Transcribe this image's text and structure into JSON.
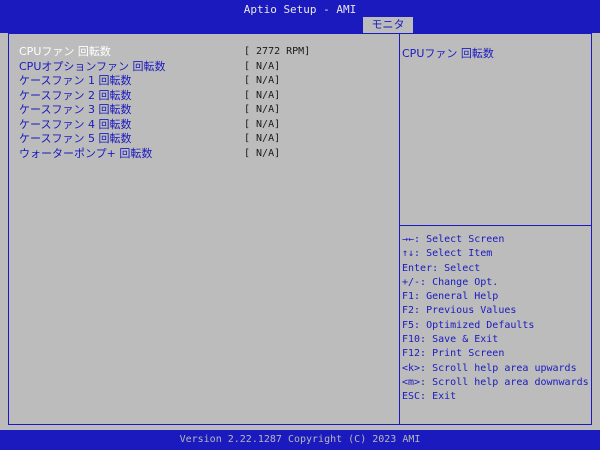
{
  "header": {
    "app_title": "Aptio Setup - AMI",
    "tab_label": "モニタ"
  },
  "settings": [
    {
      "label": "CPUファン 回転数",
      "value": "[  2772 RPM]"
    },
    {
      "label": "CPUオプションファン 回転数",
      "value": "[  N/A]"
    },
    {
      "label": "ケースファン 1 回転数",
      "value": "[  N/A]"
    },
    {
      "label": "ケースファン 2 回転数",
      "value": "[  N/A]"
    },
    {
      "label": "ケースファン 3 回転数",
      "value": "[  N/A]"
    },
    {
      "label": "ケースファン 4 回転数",
      "value": "[  N/A]"
    },
    {
      "label": "ケースファン 5 回転数",
      "value": "[  N/A]"
    },
    {
      "label": "ウォーターポンプ+ 回転数",
      "value": "[  N/A]"
    }
  ],
  "help": {
    "title": "CPUファン 回転数"
  },
  "key_help": [
    "→←: Select Screen",
    "↑↓: Select Item",
    "Enter: Select",
    "+/-: Change Opt.",
    "F1: General Help",
    "F2: Previous Values",
    "F5: Optimized Defaults",
    "F10: Save & Exit",
    "F12: Print Screen",
    "<k>: Scroll help area upwards",
    "<m>: Scroll help area downwards",
    "ESC: Exit"
  ],
  "footer": {
    "text": "Version 2.22.1287 Copyright (C) 2023 AMI"
  },
  "colors": {
    "bios_blue": "#1a1abf",
    "background_gray": "#bcbcbc",
    "highlight_white": "#ffffff"
  }
}
